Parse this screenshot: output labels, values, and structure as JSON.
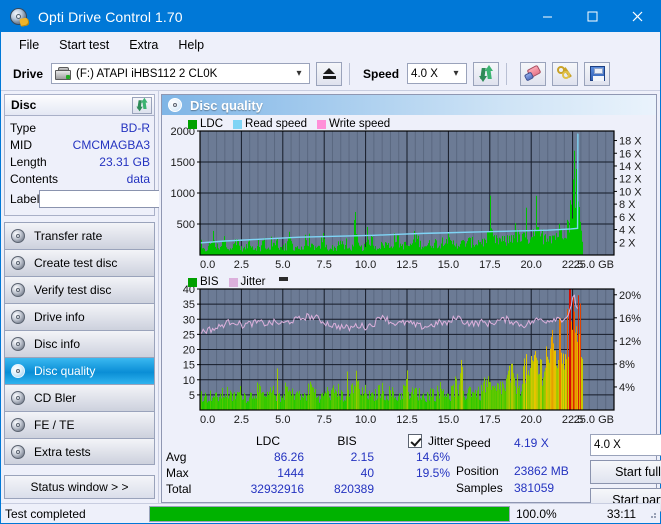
{
  "window": {
    "title": "Opti Drive Control 1.70",
    "icon": "optical-disc-icon",
    "minimize": "minimize",
    "maximize": "maximize",
    "close": "close"
  },
  "menu": {
    "items": [
      "File",
      "Start test",
      "Extra",
      "Help"
    ]
  },
  "toolbar": {
    "drive_label": "Drive",
    "drive_value": "(F:)  ATAPI iHBS112  2 CL0K",
    "eject_title": "Eject",
    "speed_label": "Speed",
    "speed_value": "4.0 X",
    "refresh_title": "Refresh",
    "erase_title": "Erase",
    "keys_title": "Keys",
    "save_title": "Save"
  },
  "disc": {
    "header": "Disc",
    "refresh_title": "Refresh disc info",
    "rows": [
      {
        "key": "Type",
        "value": "BD-R"
      },
      {
        "key": "MID",
        "value": "CMCMAGBA3"
      },
      {
        "key": "Length",
        "value": "23.31 GB"
      },
      {
        "key": "Contents",
        "value": "data"
      }
    ],
    "label_key": "Label",
    "label_value": "",
    "label_placeholder": "",
    "disc_button_title": "Disc label"
  },
  "sidebar": {
    "items": [
      {
        "label": "Transfer rate",
        "active": false
      },
      {
        "label": "Create test disc",
        "active": false
      },
      {
        "label": "Verify test disc",
        "active": false
      },
      {
        "label": "Drive info",
        "active": false
      },
      {
        "label": "Disc info",
        "active": false
      },
      {
        "label": "Disc quality",
        "active": true
      },
      {
        "label": "CD Bler",
        "active": false
      },
      {
        "label": "FE / TE",
        "active": false
      },
      {
        "label": "Extra tests",
        "active": false
      }
    ],
    "status_window": "Status window > >"
  },
  "panel": {
    "title": "Disc quality",
    "icon": "disc-quality-icon"
  },
  "stats": {
    "col_headers": [
      "LDC",
      "BIS"
    ],
    "jitter_label": "Jitter",
    "jitter_checked": true,
    "rows": [
      {
        "name": "Avg",
        "ldc": "86.26",
        "bis": "2.15",
        "jitter": "14.6%"
      },
      {
        "name": "Max",
        "ldc": "1444",
        "bis": "40",
        "jitter": "19.5%"
      },
      {
        "name": "Total",
        "ldc": "32932916",
        "bis": "820389",
        "jitter": ""
      }
    ]
  },
  "controls": {
    "speed_label": "Speed",
    "speed_value": "4.19 X",
    "speed_select": "4.0 X",
    "position_label": "Position",
    "position_value": "23862 MB",
    "samples_label": "Samples",
    "samples_value": "381059",
    "start_full": "Start full",
    "start_part": "Start part"
  },
  "statusbar": {
    "text": "Test completed",
    "percent_label": "100.0%",
    "percent_value": 100,
    "time": "33:11",
    "fill_color": "#00b200"
  },
  "colors": {
    "accent": "#0078d7",
    "ldc_green": "#00c000",
    "read_speed": "#7fd4f5",
    "write_speed": "#ff8fd8",
    "jitter_pink": "#dcb0dc",
    "plot_bg": "#6c7b95",
    "value_blue": "#2433c0"
  },
  "chart_data": [
    {
      "type": "area",
      "name": "top-chart",
      "title": "",
      "xlabel": "GB",
      "x_ticks": [
        "0.0",
        "2.5",
        "5.0",
        "7.5",
        "10.0",
        "12.5",
        "15.0",
        "17.5",
        "20.0",
        "22.5",
        "25.0 GB"
      ],
      "xlim": [
        0,
        25
      ],
      "ylabel": "",
      "y_ticks": [
        "500",
        "1000",
        "1500",
        "2000"
      ],
      "ylim": [
        0,
        2000
      ],
      "y2_ticks": [
        "2 X",
        "4 X",
        "6 X",
        "8 X",
        "10 X",
        "12 X",
        "14 X",
        "16 X",
        "18 X"
      ],
      "y2lim": [
        0,
        19.5
      ],
      "grid": true,
      "legend": [
        {
          "name": "LDC",
          "color": "#00a000"
        },
        {
          "name": "Read speed",
          "color": "#7fd4f5"
        },
        {
          "name": "Write speed",
          "color": "#ff8fd8"
        }
      ],
      "series": [
        {
          "name": "LDC",
          "color": "#00c000",
          "kind": "bars",
          "x": [
            0.1,
            0.3,
            0.5,
            0.8,
            1.0,
            1.2,
            1.45,
            1.6,
            1.8,
            2.0,
            2.2,
            2.4,
            2.6,
            2.8,
            3.0,
            3.2,
            3.4,
            3.6,
            3.8,
            4.0,
            4.2,
            4.4,
            4.6,
            4.8,
            5.0,
            5.2,
            5.4,
            5.6,
            5.8,
            6.0,
            6.2,
            6.4,
            6.6,
            6.8,
            7.0,
            7.2,
            7.4,
            7.6,
            7.8,
            8.0,
            8.2,
            8.4,
            8.6,
            8.8,
            9.0,
            9.2,
            9.4,
            9.6,
            9.8,
            10.0,
            10.3,
            10.6,
            10.9,
            11.2,
            11.5,
            11.8,
            12.1,
            12.4,
            12.7,
            13.0,
            13.3,
            13.6,
            13.9,
            14.2,
            14.5,
            14.8,
            15.1,
            15.4,
            15.7,
            16.0,
            16.3,
            16.6,
            16.9,
            17.2,
            17.5,
            17.8,
            18.1,
            18.4,
            18.7,
            19.0,
            19.3,
            19.6,
            19.9,
            20.2,
            20.5,
            20.8,
            21.1,
            21.4,
            21.7,
            22.0,
            22.3,
            22.6,
            22.75,
            22.85,
            22.95,
            23.0
          ],
          "values": [
            95,
            70,
            120,
            300,
            85,
            95,
            260,
            110,
            90,
            140,
            300,
            110,
            95,
            125,
            250,
            100,
            130,
            90,
            240,
            110,
            95,
            150,
            280,
            100,
            120,
            95,
            320,
            110,
            140,
            100,
            95,
            260,
            120,
            150,
            100,
            110,
            290,
            130,
            100,
            120,
            95,
            250,
            140,
            110,
            100,
            130,
            300,
            120,
            110,
            140,
            260,
            120,
            150,
            180,
            130,
            300,
            150,
            160,
            140,
            320,
            170,
            150,
            180,
            200,
            160,
            330,
            180,
            190,
            170,
            200,
            210,
            190,
            230,
            200,
            340,
            220,
            240,
            210,
            260,
            380,
            250,
            270,
            300,
            420,
            290,
            320,
            340,
            300,
            380,
            450,
            520,
            1444,
            900,
            700,
            520,
            380
          ]
        },
        {
          "name": "Read speed",
          "color": "#7fd4f5",
          "kind": "line",
          "x": [
            0.0,
            1.5,
            3.0,
            4.5,
            6.0,
            7.5,
            9.0,
            10.5,
            12.0,
            13.5,
            15.0,
            16.5,
            18.0,
            19.5,
            21.0,
            22.4,
            22.8,
            22.82,
            22.85
          ],
          "values": [
            1.9,
            2.2,
            2.4,
            2.6,
            2.8,
            2.9,
            3.0,
            3.1,
            3.25,
            3.4,
            3.5,
            3.6,
            3.7,
            3.8,
            3.9,
            4.1,
            4.19,
            19.0,
            19.0
          ]
        }
      ]
    },
    {
      "type": "area",
      "name": "bottom-chart",
      "title": "",
      "xlabel": "GB",
      "x_ticks": [
        "0.0",
        "2.5",
        "5.0",
        "7.5",
        "10.0",
        "12.5",
        "15.0",
        "17.5",
        "20.0",
        "22.5",
        "25.0 GB"
      ],
      "xlim": [
        0,
        25
      ],
      "ylabel": "",
      "y_ticks": [
        "5",
        "10",
        "15",
        "20",
        "25",
        "30",
        "35",
        "40"
      ],
      "ylim": [
        0,
        40
      ],
      "y2_ticks": [
        "4%",
        "8%",
        "12%",
        "16%",
        "20%"
      ],
      "y2lim": [
        0,
        21
      ],
      "grid": true,
      "legend": [
        {
          "name": "BIS",
          "color": "#00a000"
        },
        {
          "name": "Jitter",
          "color": "#dcb0dc"
        }
      ],
      "series": [
        {
          "name": "BIS",
          "color": "gradient-green-yellow-orange-red",
          "kind": "bars",
          "x": [
            0.1,
            0.4,
            0.7,
            1.0,
            1.3,
            1.6,
            1.9,
            2.2,
            2.5,
            2.8,
            3.1,
            3.4,
            3.7,
            4.0,
            4.3,
            4.6,
            4.9,
            5.2,
            5.5,
            5.8,
            6.1,
            6.4,
            6.7,
            7.0,
            7.3,
            7.6,
            7.9,
            8.2,
            8.5,
            8.8,
            9.1,
            9.4,
            9.7,
            10.0,
            10.3,
            10.6,
            10.9,
            11.2,
            11.5,
            11.8,
            12.1,
            12.4,
            12.7,
            13.0,
            13.3,
            13.6,
            13.9,
            14.2,
            14.5,
            14.8,
            15.1,
            15.4,
            15.7,
            16.0,
            16.3,
            16.6,
            16.9,
            17.2,
            17.5,
            17.8,
            18.1,
            18.4,
            18.7,
            19.0,
            19.3,
            19.6,
            19.9,
            20.2,
            20.5,
            20.8,
            21.1,
            21.4,
            21.7,
            22.0,
            22.3,
            22.5,
            22.65,
            22.75,
            22.85,
            22.95
          ],
          "values": [
            5,
            4,
            5,
            4,
            5,
            6,
            4,
            5,
            6,
            4,
            5,
            7,
            5,
            4,
            6,
            5,
            4,
            7,
            5,
            6,
            4,
            5,
            8,
            5,
            4,
            6,
            5,
            7,
            5,
            4,
            6,
            10,
            5,
            6,
            4,
            5,
            7,
            5,
            6,
            4,
            5,
            8,
            5,
            6,
            5,
            4,
            6,
            5,
            7,
            6,
            5,
            8,
            6,
            5,
            7,
            6,
            5,
            9,
            7,
            6,
            8,
            7,
            12,
            9,
            8,
            14,
            10,
            18,
            13,
            16,
            20,
            17,
            22,
            19,
            30,
            40,
            38,
            34,
            30,
            26
          ]
        },
        {
          "name": "Jitter",
          "color": "#dcb0dc",
          "kind": "line",
          "x": [
            0.1,
            0.5,
            1.0,
            1.5,
            2.0,
            2.5,
            3.0,
            3.5,
            4.0,
            4.5,
            5.0,
            5.5,
            6.0,
            6.5,
            7.0,
            7.5,
            8.0,
            8.5,
            9.0,
            9.5,
            10.0,
            10.5,
            11.0,
            11.5,
            12.0,
            12.5,
            13.0,
            13.5,
            14.0,
            14.5,
            15.0,
            15.5,
            16.0,
            16.5,
            17.0,
            17.5,
            18.0,
            18.5,
            19.0,
            19.5,
            20.0,
            20.5,
            21.0,
            21.5,
            22.0,
            22.4,
            22.6,
            22.75
          ],
          "values": [
            26.0,
            26.5,
            27.0,
            28.5,
            29.5,
            28.0,
            28.5,
            29.0,
            28.5,
            29.0,
            28.5,
            29.5,
            30.0,
            31.0,
            30.5,
            29.0,
            28.0,
            27.5,
            27.0,
            28.0,
            27.5,
            28.5,
            31.5,
            29.0,
            28.5,
            29.0,
            28.0,
            27.5,
            28.0,
            29.0,
            28.5,
            31.0,
            29.0,
            28.5,
            29.0,
            28.5,
            29.5,
            30.0,
            29.0,
            28.0,
            29.0,
            30.0,
            29.5,
            30.5,
            30.0,
            33.0,
            39.0,
            33.0
          ]
        }
      ]
    }
  ]
}
